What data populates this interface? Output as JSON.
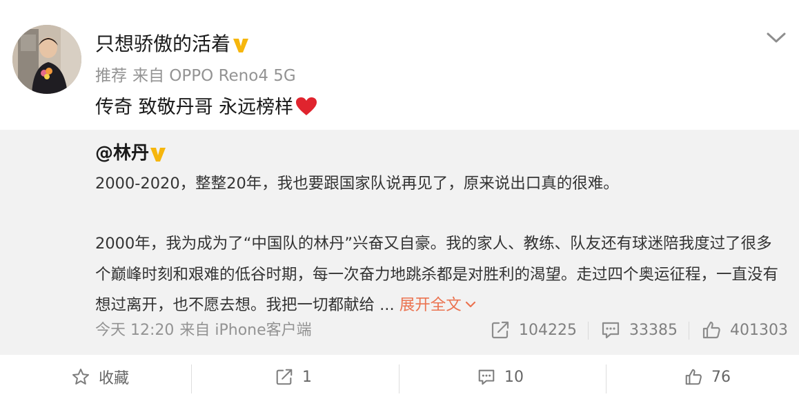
{
  "post": {
    "username": "只想骄傲的活着",
    "tag": "推荐",
    "via": "来自 OPPO Reno4 5G",
    "text": "传奇 致敬丹哥 永远榜样",
    "emoji": "heart-emoji"
  },
  "repost": {
    "author": "@林丹",
    "para1": "2000-2020，整整20年，我也要跟国家队说再见了，原来说出口真的很难。",
    "para2": "2000年，我为成为了“中国队的林丹”兴奋又自豪。我的家人、教练、队友还有球迷陪我度过了很多个巅峰时刻和艰难的低谷时期，每一次奋力地跳杀都是对胜利的渴望。走过四个奥运征程，一直没有想过离开，也不愿去想。我把一切都献给 ...",
    "expand_label": "展开全文",
    "time": "今天 12:20",
    "via": "来自 iPhone客户端",
    "stats": {
      "shares": "104225",
      "comments": "33385",
      "likes": "401303"
    }
  },
  "actions": {
    "favorite_label": "收藏",
    "share_count": "1",
    "comment_count": "10",
    "like_count": "76"
  },
  "colors": {
    "verified_badge": "#f6b60d",
    "link": "#eb7350",
    "repost_bg": "#f2f2f2",
    "meta_text": "#939393",
    "heart": "#e0242e"
  },
  "icons": [
    "verified-badge-icon",
    "chevron-down-icon",
    "heart-emoji-icon",
    "share-icon",
    "comment-icon",
    "thumbs-up-icon",
    "star-icon"
  ]
}
